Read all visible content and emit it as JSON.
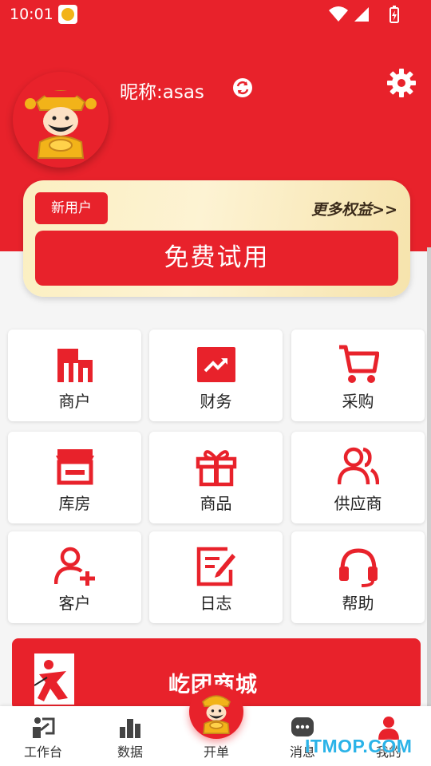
{
  "status_bar": {
    "time": "10:01"
  },
  "profile": {
    "nickname_label": "昵称:",
    "nickname_value": "asas",
    "icons": [
      "refresh-icon",
      "gear-icon"
    ]
  },
  "member_card": {
    "badge": "新用户",
    "more_rights": "更多权益>>",
    "cta": "免费试用"
  },
  "grid": {
    "items": [
      {
        "label": "商户",
        "icon": "store-building-icon"
      },
      {
        "label": "财务",
        "icon": "trend-chart-icon"
      },
      {
        "label": "采购",
        "icon": "shopping-cart-icon"
      },
      {
        "label": "库房",
        "icon": "warehouse-icon"
      },
      {
        "label": "商品",
        "icon": "gift-icon"
      },
      {
        "label": "供应商",
        "icon": "suppliers-icon"
      },
      {
        "label": "客户",
        "icon": "add-customer-icon"
      },
      {
        "label": "日志",
        "icon": "edit-log-icon"
      },
      {
        "label": "帮助",
        "icon": "headset-icon"
      }
    ]
  },
  "mall_banner": {
    "title": "屹团商城"
  },
  "bottom_nav": {
    "items": [
      {
        "label": "工作台",
        "icon": "workbench-icon"
      },
      {
        "label": "数据",
        "icon": "bar-chart-icon"
      },
      {
        "label": "开单",
        "icon": "mascot-icon"
      },
      {
        "label": "消息",
        "icon": "chat-icon"
      },
      {
        "label": "我的",
        "icon": "user-icon"
      }
    ]
  },
  "watermark": "ITMOP.COM",
  "colors": {
    "brand_red": "#e8222b",
    "card_gold": "#fbefc1",
    "watermark_blue": "#2bb3e8"
  }
}
